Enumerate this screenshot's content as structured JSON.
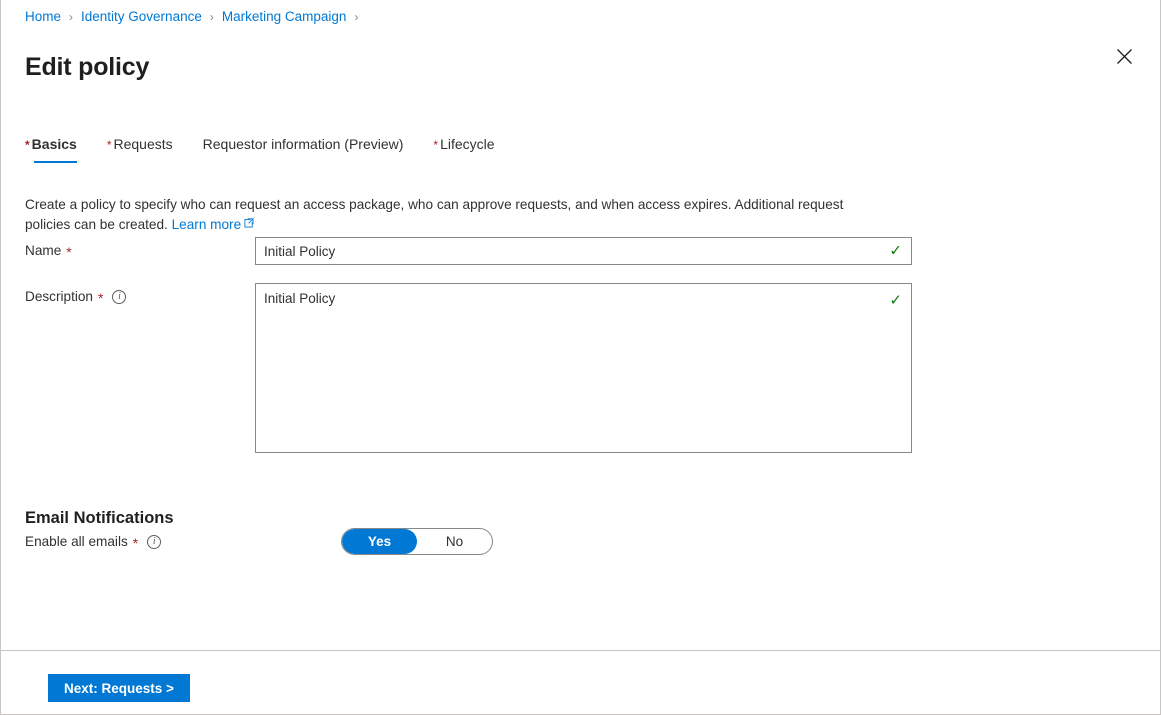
{
  "breadcrumb": {
    "separator": "›",
    "items": [
      {
        "label": "Home"
      },
      {
        "label": "Identity Governance"
      },
      {
        "label": "Marketing Campaign"
      }
    ]
  },
  "header": {
    "title": "Edit policy",
    "close_icon": "close-icon"
  },
  "tabs": [
    {
      "label": "Basics",
      "required": "*",
      "active": true
    },
    {
      "label": "Requests",
      "required": "*",
      "active": false
    },
    {
      "label": "Requestor information (Preview)",
      "required": "",
      "active": false
    },
    {
      "label": "Lifecycle",
      "required": "*",
      "active": false
    }
  ],
  "intro": {
    "text": "Create a policy to specify who can request an access package, who can approve requests, and when access expires. Additional request policies can be created.",
    "link_label": "Learn more"
  },
  "form": {
    "name": {
      "label": "Name",
      "required": "*",
      "value": "Initial Policy",
      "placeholder": "",
      "valid_icon": "✓"
    },
    "description": {
      "label": "Description",
      "required": "*",
      "value": "Initial Policy",
      "placeholder": "",
      "valid_icon": "✓",
      "info_icon": "i"
    }
  },
  "email_notifications": {
    "heading": "Email Notifications",
    "enable_all": {
      "label": "Enable all emails",
      "required": "*",
      "info_icon": "i",
      "options": [
        {
          "label": "Yes",
          "selected": true
        },
        {
          "label": "No",
          "selected": false
        }
      ]
    }
  },
  "footer": {
    "next_label": "Next: Requests >"
  },
  "colors": {
    "accent": "#0078d4",
    "required": "#a4262c",
    "valid": "#107c10",
    "border": "#8a8886",
    "text": "#323130"
  }
}
